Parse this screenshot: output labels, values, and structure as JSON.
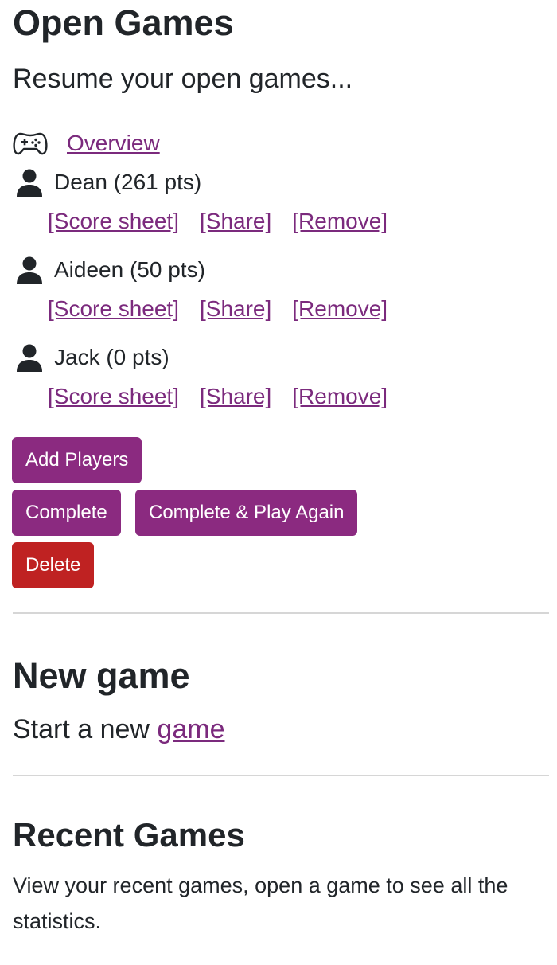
{
  "open_games": {
    "title": "Open Games",
    "lead": "Resume your open games...",
    "overview_label": "Overview",
    "players": [
      {
        "name": "Dean (261 pts)"
      },
      {
        "name": "Aideen (50 pts)"
      },
      {
        "name": "Jack (0 pts)"
      }
    ],
    "actions": {
      "score_sheet": "[Score sheet]",
      "share": "[Share]",
      "remove": "[Remove]"
    },
    "buttons": {
      "add_players": "Add Players",
      "complete": "Complete",
      "complete_play_again": "Complete & Play Again",
      "delete": "Delete"
    }
  },
  "new_game": {
    "title": "New game",
    "lead_prefix": "Start a new ",
    "lead_link": "game"
  },
  "recent_games": {
    "title": "Recent Games",
    "text": "View your recent games, open a game to see all the statistics."
  },
  "colors": {
    "primary": "#8b2a80",
    "danger": "#bf2222",
    "link": "#7b2a7d"
  },
  "icons": {
    "overview": "gamepad-icon",
    "player": "person-icon"
  }
}
